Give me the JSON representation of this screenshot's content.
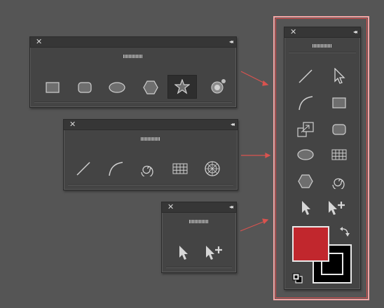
{
  "panels": {
    "shapes": {
      "close": "✕",
      "collapse": "◂◂",
      "tools": [
        "rectangle-tool",
        "rounded-rectangle-tool",
        "ellipse-tool",
        "polygon-tool",
        "star-tool",
        "flare-tool"
      ],
      "active_tool": "star-tool"
    },
    "lines": {
      "close": "✕",
      "collapse": "◂◂",
      "tools": [
        "line-segment-tool",
        "arc-tool",
        "spiral-tool",
        "rectangular-grid-tool",
        "polar-grid-tool"
      ]
    },
    "selection": {
      "close": "✕",
      "collapse": "◂◂",
      "tools": [
        "selection-tool",
        "add-selection-tool"
      ]
    },
    "toolbar": {
      "close": "✕",
      "collapse": "◂◂",
      "tools": [
        "line-segment-tool",
        "direct-selection-tool",
        "arc-tool",
        "rectangle-tool",
        "scale-tool",
        "rounded-rectangle-tool",
        "ellipse-tool",
        "rectangular-grid-tool",
        "polygon-tool",
        "spiral-tool",
        "selection-tool",
        "add-selection-tool"
      ]
    }
  },
  "colors": {
    "fill": "#c1272d",
    "stroke": "#000000",
    "connector": "#d9534f",
    "highlight": "#f2a5a5"
  }
}
